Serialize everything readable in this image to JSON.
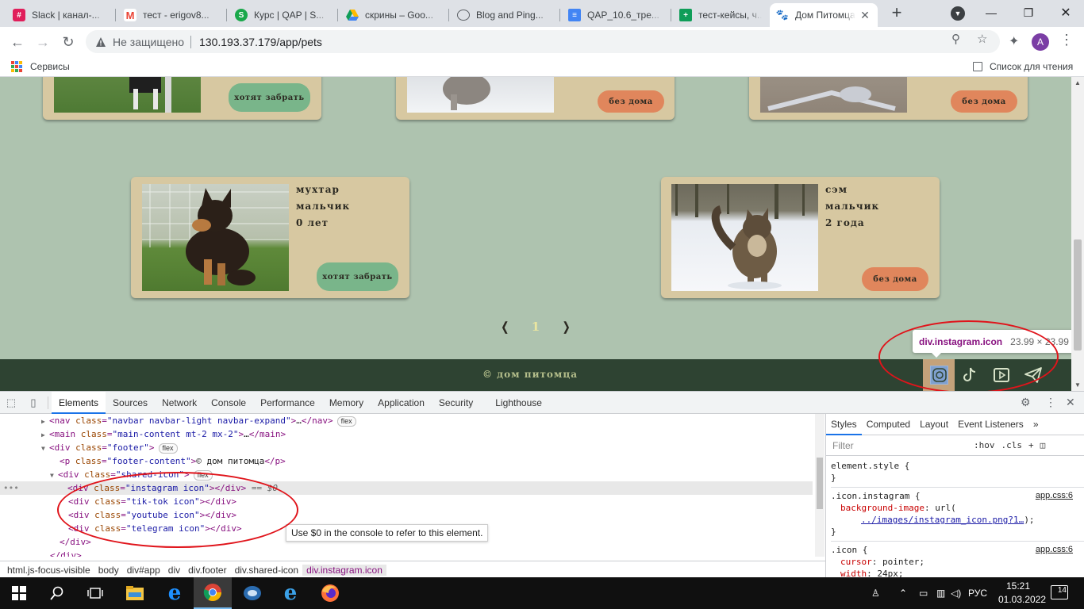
{
  "browser": {
    "tabs": [
      {
        "title": "Slack | канал-...",
        "favicon": "slack-icon",
        "color": "#e01e5a"
      },
      {
        "title": "тест - erigov8...",
        "favicon": "gmail-icon",
        "color": "#ea4335"
      },
      {
        "title": "Курс | QAP | S...",
        "favicon": "skillfactory-icon",
        "color": "#19a84a"
      },
      {
        "title": "скрины – Goo...",
        "favicon": "google-drive-icon",
        "color": "#1fa463"
      },
      {
        "title": "Blog and Ping...",
        "favicon": "globe-icon",
        "color": "#5f6368"
      },
      {
        "title": "QAP_10.6_тре...",
        "favicon": "google-docs-icon",
        "color": "#4285f4"
      },
      {
        "title": "тест-кейсы, ч...",
        "favicon": "google-sheets-icon",
        "color": "#0f9d58"
      },
      {
        "title": "Дом Питомца",
        "favicon": "pet-site-icon",
        "color": "#222222"
      }
    ],
    "new_tab": "+",
    "url_security": "Не защищено",
    "url": "130.193.37.179/app/pets",
    "profile_initial": "A",
    "profile_color": "#7b3ea5"
  },
  "bookmarks": {
    "services": "Сервисы",
    "reading_list": "Список для чтения"
  },
  "page": {
    "top_cards": [
      {
        "status": "хотят забрать",
        "status_kind": "want"
      },
      {
        "status": "без дома",
        "status_kind": "home"
      },
      {
        "status": "без дома",
        "status_kind": "home"
      }
    ],
    "cards": [
      {
        "name": "мухтар",
        "gender": "мальчик",
        "age": "0 лет",
        "status": "хотят забрать",
        "status_kind": "want"
      },
      {
        "name": "сэм",
        "gender": "мальчик",
        "age": "2 года",
        "status": "без дома",
        "status_kind": "home"
      }
    ],
    "pager": {
      "prev": "❬",
      "current": "1",
      "next": "❭"
    },
    "footer": {
      "text": "© дом питомца",
      "icons": [
        "instagram-icon",
        "tiktok-icon",
        "youtube-icon",
        "telegram-icon"
      ]
    },
    "inspect_tooltip": {
      "selector": "div.instagram.icon",
      "size": "23.99 × 23.99"
    },
    "colors": {
      "background": "#aec3af",
      "card": "#d7c8a1",
      "want": "#79b58a",
      "home": "#e0865c",
      "footer": "#2e4332"
    }
  },
  "devtools": {
    "tabs": [
      "Elements",
      "Sources",
      "Network",
      "Console",
      "Performance",
      "Memory",
      "Application",
      "Security",
      "Lighthouse"
    ],
    "active_tab": "Elements",
    "dom": {
      "nav": "navbar navbar-light navbar-expand",
      "main": "main-content mt-2 mx-2",
      "footer": "footer",
      "footer_p": "footer-content",
      "footer_p_text": "© дом питомца",
      "shared": "shared-icon",
      "children": [
        "instagram icon",
        "tik-tok icon",
        "youtube icon",
        "telegram icon"
      ],
      "selected_marker": "== $0",
      "flex_badge": "flex",
      "ellipsis": "…"
    },
    "hint": "Use $0 in the console to refer to this element.",
    "breadcrumbs": [
      "html.js-focus-visible",
      "body",
      "div#app",
      "div",
      "div.footer",
      "div.shared-icon",
      "div.instagram.icon"
    ],
    "styles": {
      "tabs": [
        "Styles",
        "Computed",
        "Layout",
        "Event Listeners"
      ],
      "filter_placeholder": "Filter",
      "hov": ":hov",
      "cls": ".cls",
      "element_style": "element.style {",
      "close_brace": "}",
      "rule1_selector": ".icon.instagram {",
      "rule1_source": "app.css:6",
      "rule1_prop": "background-image",
      "rule1_value_prefix": "url(",
      "rule1_link": "../images/instagram_icon.png?1…",
      "rule1_value_suffix": ");",
      "rule2_selector": ".icon {",
      "rule2_source": "app.css:6",
      "rule2_prop1": "cursor",
      "rule2_val1": "pointer;",
      "rule2_prop2": "width",
      "rule2_val2": "24px;"
    }
  },
  "taskbar": {
    "time": "15:21",
    "date": "01.03.2022",
    "lang": "РУС",
    "notifications": "14"
  }
}
